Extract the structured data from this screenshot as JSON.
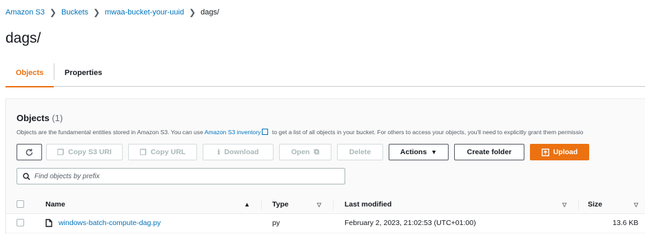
{
  "breadcrumb": {
    "items": [
      "Amazon S3",
      "Buckets",
      "mwaa-bucket-your-uuid"
    ],
    "separator": ">",
    "current": "dags/"
  },
  "page": {
    "title": "dags/"
  },
  "tabs": [
    {
      "label": "Objects",
      "active": true
    },
    {
      "label": "Properties",
      "active": false
    }
  ],
  "objects_panel": {
    "title": "Objects",
    "count": "(1)",
    "description_prefix": "Objects are the fundamental entities stored in Amazon S3. You can use ",
    "description_link": "Amazon S3 inventory",
    "description_suffix": " to get a list of all objects in your bucket. For others to access your objects, you'll need to explicitly grant them permissio"
  },
  "toolbar": {
    "refresh_icon": "refresh-icon",
    "copy_s3_uri": "Copy S3 URI",
    "copy_url": "Copy URL",
    "download": "Download",
    "open": "Open",
    "delete": "Delete",
    "actions": "Actions",
    "create_folder": "Create folder",
    "upload": "Upload"
  },
  "search": {
    "placeholder": "Find objects by prefix",
    "value": ""
  },
  "table": {
    "columns": [
      "Name",
      "Type",
      "Last modified",
      "Size"
    ],
    "rows": [
      {
        "name": "windows-batch-compute-dag.py",
        "type": "py",
        "last_modified": "February 2, 2023, 21:02:53 (UTC+01:00)",
        "size": "13.6 KB"
      }
    ]
  },
  "colors": {
    "accent": "#ec7211",
    "link": "#0073bb",
    "text": "#16191f"
  }
}
